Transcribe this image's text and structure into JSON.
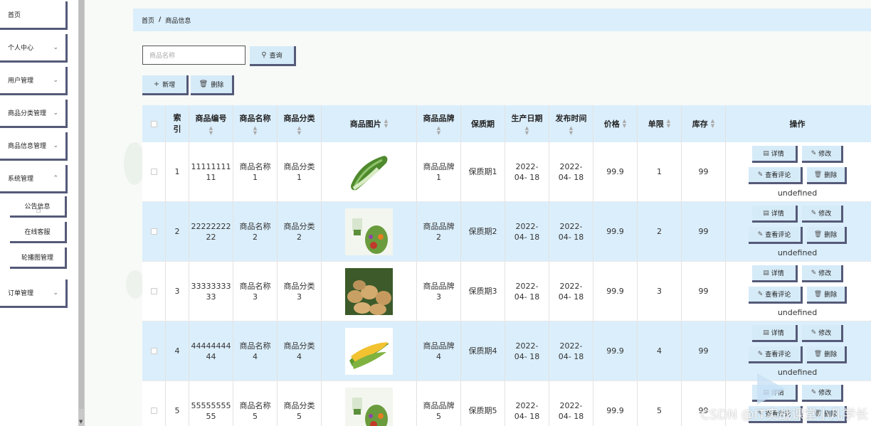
{
  "sidebar": {
    "items": [
      {
        "label": "首页",
        "has_chevron": false
      },
      {
        "label": "个人中心",
        "has_chevron": true
      },
      {
        "label": "用户管理",
        "has_chevron": true
      },
      {
        "label": "商品分类管理",
        "has_chevron": true
      },
      {
        "label": "商品信息管理",
        "has_chevron": true
      },
      {
        "label": "系统管理",
        "has_chevron": true
      },
      {
        "label": "订单管理",
        "has_chevron": true
      }
    ],
    "sub_items": [
      {
        "label": "公告信息"
      },
      {
        "label": "在线客服"
      },
      {
        "label": "轮播图管理"
      }
    ]
  },
  "breadcrumb": {
    "home": "首页",
    "separator": "/",
    "current": "商品信息"
  },
  "search": {
    "placeholder": "商品名称",
    "button_label": "查询"
  },
  "toolbar": {
    "add_label": "新增",
    "delete_label": "删除"
  },
  "table": {
    "headers": {
      "index": "索引",
      "code": "商品编号",
      "name": "商品名称",
      "category": "商品分类",
      "image": "商品图片",
      "brand": "商品品牌",
      "shelf_life": "保质期",
      "production_date": "生产日期",
      "publish_time": "发布时间",
      "price": "价格",
      "limit": "单限",
      "stock": "库存",
      "actions": "操作"
    },
    "rows": [
      {
        "index": "1",
        "code": "11111111 11",
        "name": "商品名称 1",
        "category": "商品分类 1",
        "image": "bitter-melon",
        "brand": "商品品牌 1",
        "shelf_life": "保质期1",
        "production_date": "2022-04- 18",
        "publish_time": "2022-04- 18",
        "price": "99.9",
        "limit": "1",
        "stock": "99"
      },
      {
        "index": "2",
        "code": "22222222 22",
        "name": "商品名称 2",
        "category": "商品分类 2",
        "image": "vegetable-box",
        "brand": "商品品牌 2",
        "shelf_life": "保质期2",
        "production_date": "2022-04- 18",
        "publish_time": "2022-04- 18",
        "price": "99.9",
        "limit": "2",
        "stock": "99"
      },
      {
        "index": "3",
        "code": "33333333 33",
        "name": "商品名称 3",
        "category": "商品分类 3",
        "image": "potatoes",
        "brand": "商品品牌 3",
        "shelf_life": "保质期3",
        "production_date": "2022-04- 18",
        "publish_time": "2022-04- 18",
        "price": "99.9",
        "limit": "3",
        "stock": "99"
      },
      {
        "index": "4",
        "code": "44444444 44",
        "name": "商品名称 4",
        "category": "商品分类 4",
        "image": "corn",
        "brand": "商品品牌 4",
        "shelf_life": "保质期4",
        "production_date": "2022-04- 18",
        "publish_time": "2022-04- 18",
        "price": "99.9",
        "limit": "4",
        "stock": "99"
      },
      {
        "index": "5",
        "code": "55555555 55",
        "name": "商品名称 5",
        "category": "商品分类 5",
        "image": "vegetable-box",
        "brand": "商品品牌 5",
        "shelf_life": "保质期5",
        "production_date": "2022-04- 18",
        "publish_time": "2022-04- 18",
        "price": "99.9",
        "limit": "5",
        "stock": "99"
      }
    ],
    "row_actions": {
      "detail": "详情",
      "edit": "修改",
      "reviews": "查看评论",
      "delete": "删除"
    }
  },
  "watermark": "CSDN @IT实战课堂小凡学长",
  "colors": {
    "header_bg": "#dbeefb",
    "button_border": "#555a78",
    "row_alt": "#dbeefb"
  }
}
